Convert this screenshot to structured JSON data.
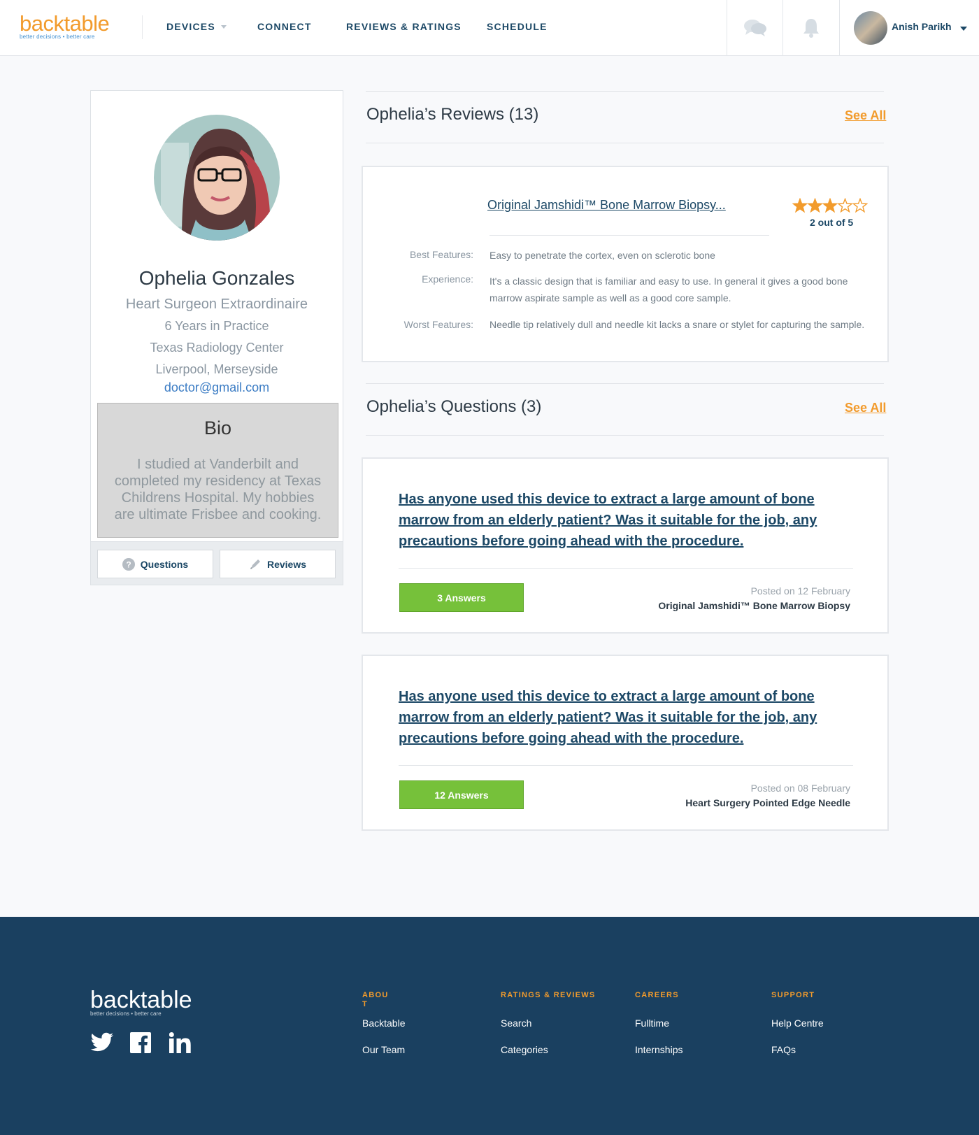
{
  "header": {
    "logo": "backtable",
    "tagline": "better decisions • better care",
    "nav": [
      "DEVICES",
      "CONNECT",
      "REVIEWS & RATINGS",
      "SCHEDULE"
    ],
    "user_name": "Anish Parikh"
  },
  "profile": {
    "name": "Ophelia Gonzales",
    "title": "Heart Surgeon Extraordinaire",
    "years": "6 Years in Practice",
    "center": "Texas Radiology Center",
    "location": "Liverpool, Merseyside",
    "email": "doctor@gmail.com",
    "bio_title": "Bio",
    "bio_text": "I studied at Vanderbilt and completed my residency at Texas Childrens Hospital. My hobbies are ultimate Frisbee and cooking.",
    "buttons": {
      "questions": "Questions",
      "reviews": "Reviews"
    }
  },
  "reviews": {
    "title": "Ophelia’s Reviews (13)",
    "see_all": "See All",
    "item": {
      "device": "Original Jamshidi™ Bone Marrow Biopsy...",
      "rating": 2,
      "rating_max": 5,
      "rating_text": "2 out of 5",
      "best_label": "Best Features:",
      "best": "Easy to penetrate the cortex, even on sclerotic bone",
      "exp_label": "Experience:",
      "exp": "It's a classic design that is familiar and easy to use. In general it gives a good bone marrow aspirate sample as well as a good core sample.",
      "worst_label": "Worst Features:",
      "worst": "Needle tip relatively dull and needle kit lacks a snare or stylet for capturing the sample."
    }
  },
  "questions": {
    "title": "Ophelia’s Questions (3)",
    "see_all": "See All",
    "items": [
      {
        "text": "Has anyone used this device to extract a large amount of bone marrow from an elderly patient? Was it suitable for the job, any precautions before going ahead with the procedure.",
        "answers": "3 Answers",
        "posted": "Posted on 12 February",
        "device": "Original Jamshidi™ Bone Marrow Biopsy"
      },
      {
        "text": "Has anyone used this device to extract a large amount of bone marrow from an elderly patient? Was it suitable for the job, any precautions before going ahead with the procedure.",
        "answers": "12 Answers",
        "posted": "Posted on 08 February",
        "device": "Heart Surgery Pointed Edge Needle"
      }
    ]
  },
  "footer": {
    "logo": "backtable",
    "tagline": "better decisions • better care",
    "columns": [
      {
        "head": "ABOU\nT",
        "links": [
          "Backtable",
          "Our Team"
        ]
      },
      {
        "head": "RATINGS & REVIEWS",
        "links": [
          "Search",
          "Categories"
        ]
      },
      {
        "head": "CAREERS",
        "links": [
          "Fulltime",
          "Internships"
        ]
      },
      {
        "head": "SUPPORT",
        "links": [
          "Help Centre",
          "FAQs"
        ]
      }
    ]
  },
  "colors": {
    "accent": "#f29b2c",
    "navy": "#1c4866",
    "green": "#76c13a",
    "footer": "#1a4060"
  }
}
